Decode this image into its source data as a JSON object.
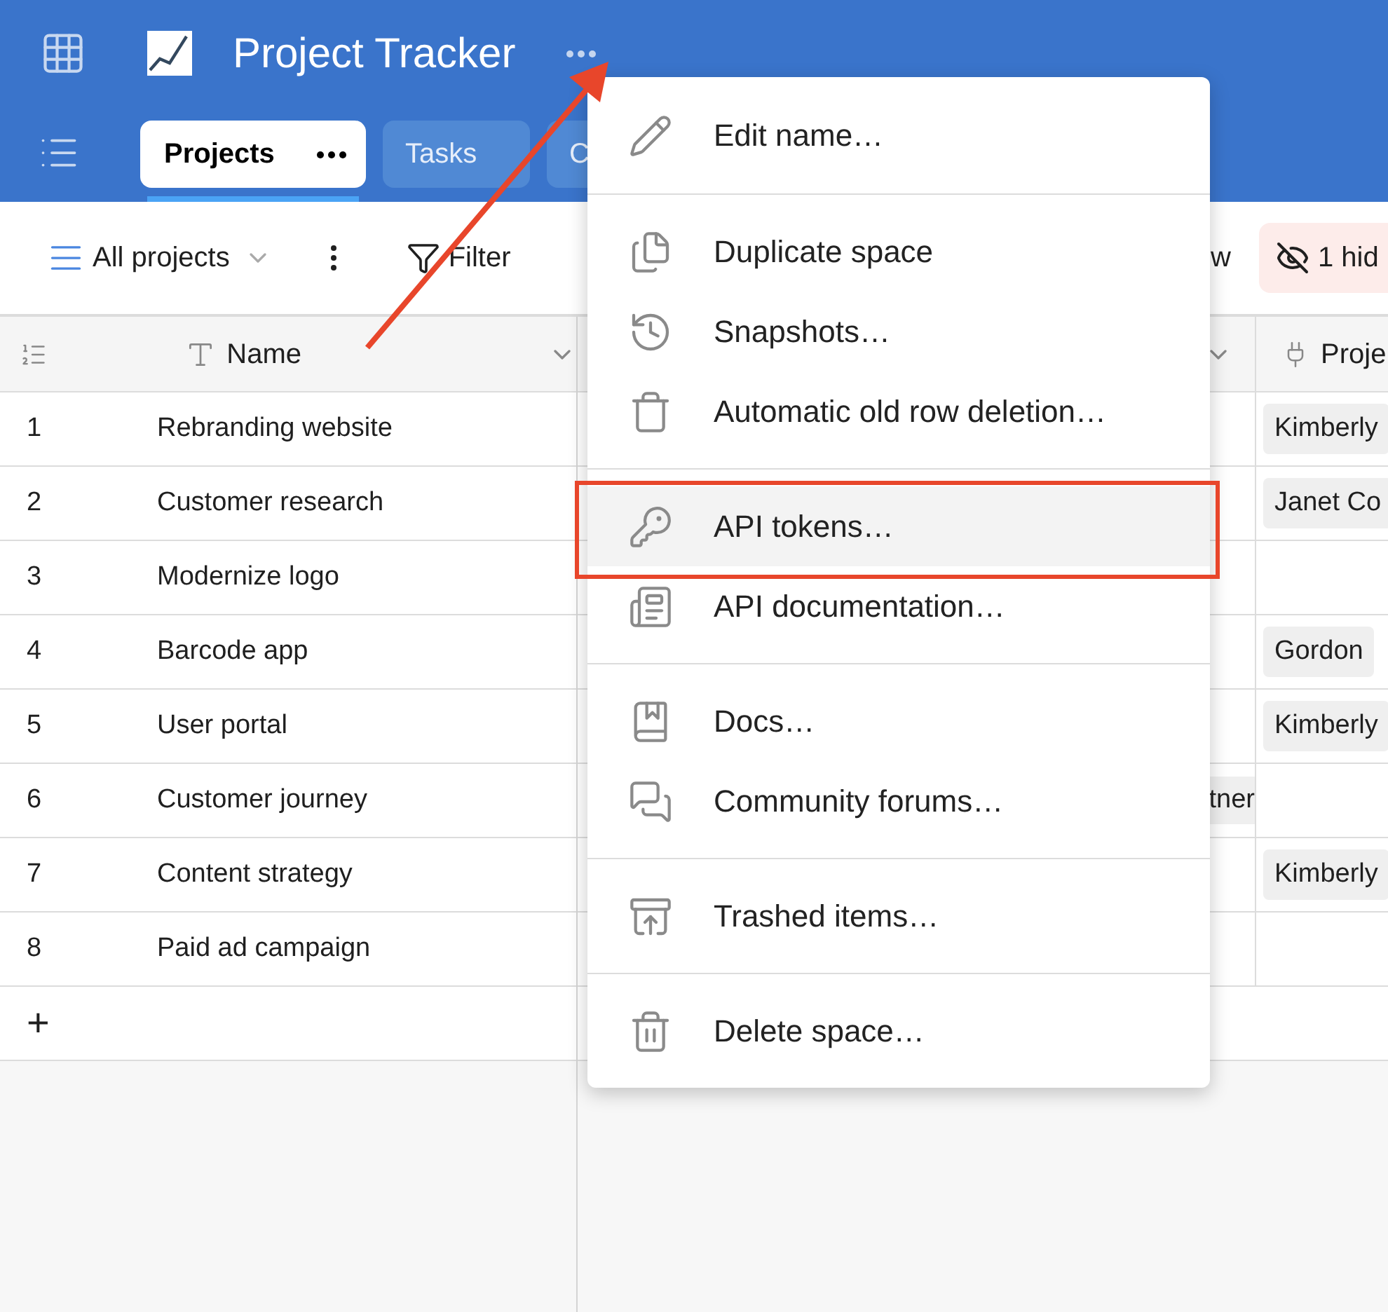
{
  "header": {
    "title": "Project Tracker",
    "tabs": [
      {
        "label": "Projects",
        "selected": true
      },
      {
        "label": "Tasks",
        "selected": false
      },
      {
        "label": "C",
        "selected": false
      }
    ]
  },
  "toolbar": {
    "view": "All projects",
    "filter": "Filter",
    "partial_button": "w",
    "hidden_fields": "1 hid"
  },
  "table": {
    "columns": [
      {
        "label": "Name"
      },
      {
        "label": "Proje"
      }
    ],
    "rows": [
      {
        "index": "1",
        "name": "Rebranding website",
        "column_4": "Kimberly"
      },
      {
        "index": "2",
        "name": "Customer research",
        "column_4": "Janet Co"
      },
      {
        "index": "3",
        "name": "Modernize logo"
      },
      {
        "index": "4",
        "name": "Barcode app",
        "column_4": "Gordon"
      },
      {
        "index": "5",
        "name": "User portal",
        "column_4": "Kimberly"
      },
      {
        "index": "6",
        "name": "Customer journey",
        "column_3": "tner"
      },
      {
        "index": "7",
        "name": "Content strategy",
        "column_4": "Kimberly"
      },
      {
        "index": "8",
        "name": "Paid ad campaign"
      }
    ],
    "add_row": "+"
  },
  "menu": {
    "sections": [
      [
        {
          "label": "Edit name…",
          "selected": false
        }
      ],
      [
        {
          "label": "Duplicate space",
          "selected": false
        },
        {
          "label": "Snapshots…",
          "selected": false
        },
        {
          "label": "Automatic old row deletion…",
          "selected": false
        }
      ],
      [
        {
          "label": "API tokens…",
          "selected": true
        },
        {
          "label": "API documentation…",
          "selected": false
        }
      ],
      [
        {
          "label": "Docs…",
          "selected": false
        },
        {
          "label": "Community forums…",
          "selected": false
        }
      ],
      [
        {
          "label": "Trashed items…",
          "selected": false
        }
      ],
      [
        {
          "label": "Delete space…",
          "selected": false
        }
      ]
    ]
  }
}
